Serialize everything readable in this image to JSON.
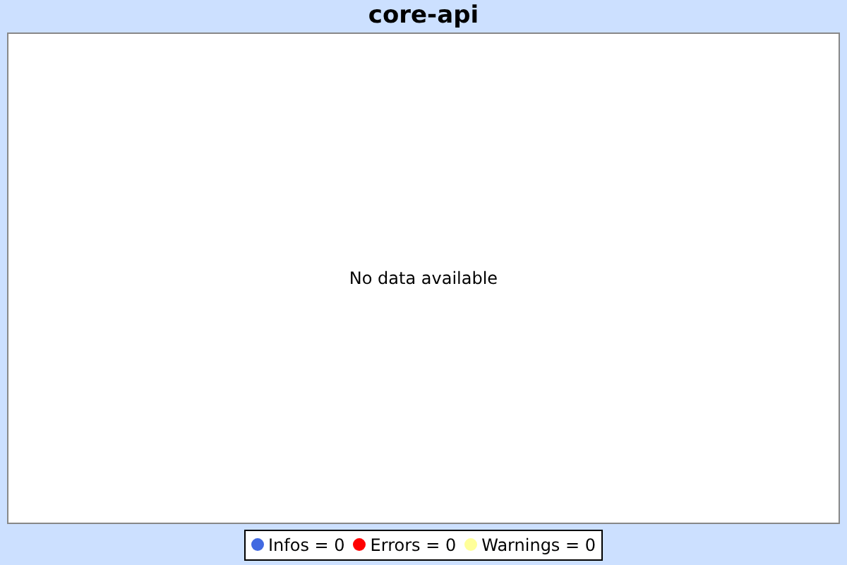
{
  "title": "core-api",
  "plot": {
    "message": "No data available"
  },
  "legend": [
    {
      "label": "Infos = 0",
      "color": "#4169e1"
    },
    {
      "label": "Errors = 0",
      "color": "#ff0000"
    },
    {
      "label": "Warnings = 0",
      "color": "#ffff99"
    }
  ]
}
